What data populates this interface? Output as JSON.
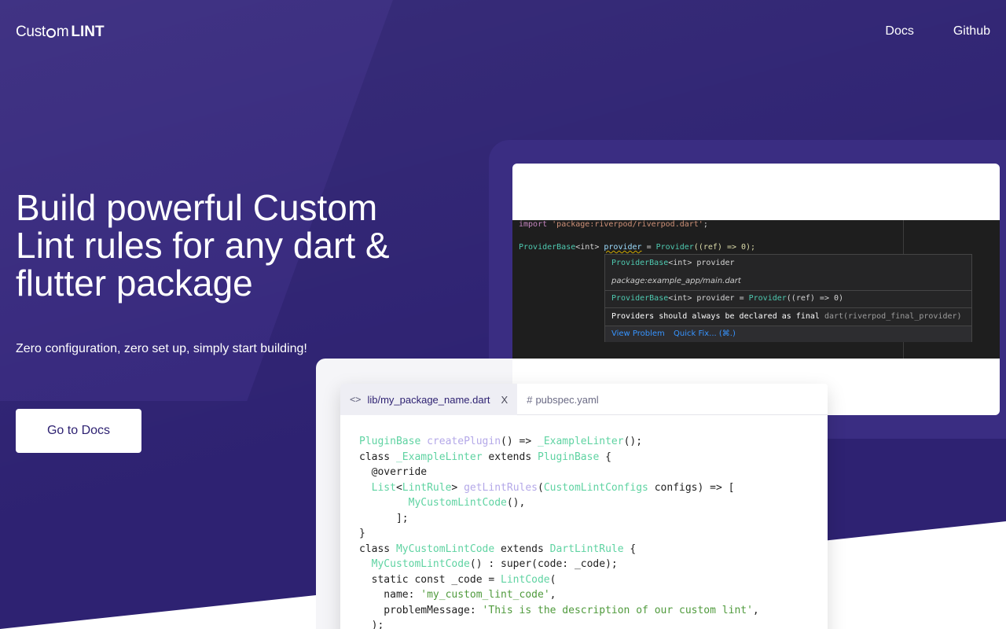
{
  "header": {
    "logo_custom": "Cust",
    "logo_m": "m",
    "logo_lint": "LINT",
    "nav": [
      "Docs",
      "Github"
    ]
  },
  "hero": {
    "title": "Build powerful Custom Lint rules for any dart & flutter package",
    "subtitle": "Zero configuration, zero set up, simply start building!",
    "cta_label": "Go to Docs"
  },
  "ide": {
    "import_kw": "import",
    "import_str": "'package:riverpod/riverpod.dart'",
    "import_end": ";",
    "decl_type": "ProviderBase",
    "decl_generic": "<int>",
    "decl_name": "provider",
    "decl_assign": " = ",
    "decl_ctor": "Provider",
    "decl_args": "((ref) => 0);",
    "hover": {
      "sig_type": "ProviderBase",
      "sig_generic": "<int>",
      "sig_name": " provider",
      "location": "package:example_app/main.dart",
      "def_type": "ProviderBase",
      "def_generic": "<int>",
      "def_rest": " provider = ",
      "def_ctor": "Provider",
      "def_args": "((ref) => 0)",
      "message": "Providers should always be declared as final ",
      "source": "dart(riverpod_final_provider)",
      "view_problem": "View Problem",
      "quick_fix": "Quick Fix... (⌘.)"
    }
  },
  "editor": {
    "tab_active": "lib/my_package_name.dart",
    "tab_active_icon": "<>",
    "tab_close": "X",
    "tab_inactive": "pubspec.yaml",
    "tab_inactive_icon": "#",
    "code": {
      "l1_type": "PluginBase",
      "l1_fn": "createPlugin",
      "l1_mid": "() => ",
      "l1_cls": "_ExampleLinter",
      "l1_end": "();",
      "l2_kw": "class ",
      "l2_cls": "_ExampleLinter",
      "l2_ext": " extends ",
      "l2_base": "PluginBase",
      "l2_end": " {",
      "l3": "  @override",
      "l4_pre": "  ",
      "l4_list": "List",
      "l4_lt": "<",
      "l4_rule": "LintRule",
      "l4_gt": "> ",
      "l4_fn": "getLintRules",
      "l4_paren": "(",
      "l4_cfg": "CustomLintConfigs",
      "l4_end": " configs) => [",
      "l5_pre": "        ",
      "l5_cls": "MyCustomLintCode",
      "l5_end": "(),",
      "l6": "      ];",
      "l7": "}",
      "l8_kw": "class ",
      "l8_cls": "MyCustomLintCode",
      "l8_ext": " extends ",
      "l8_base": "DartLintRule",
      "l8_end": " {",
      "l9_pre": "  ",
      "l9_cls": "MyCustomLintCode",
      "l9_end": "() : super(code: _code);",
      "l10_pre": "  static const _code = ",
      "l10_cls": "LintCode",
      "l10_end": "(",
      "l11_pre": "    name: ",
      "l11_str": "'my_custom_lint_code'",
      "l11_end": ",",
      "l12_pre": "    problemMessage: ",
      "l12_str": "'This is the description of our custom lint'",
      "l12_end": ",",
      "l13": "  );"
    }
  }
}
